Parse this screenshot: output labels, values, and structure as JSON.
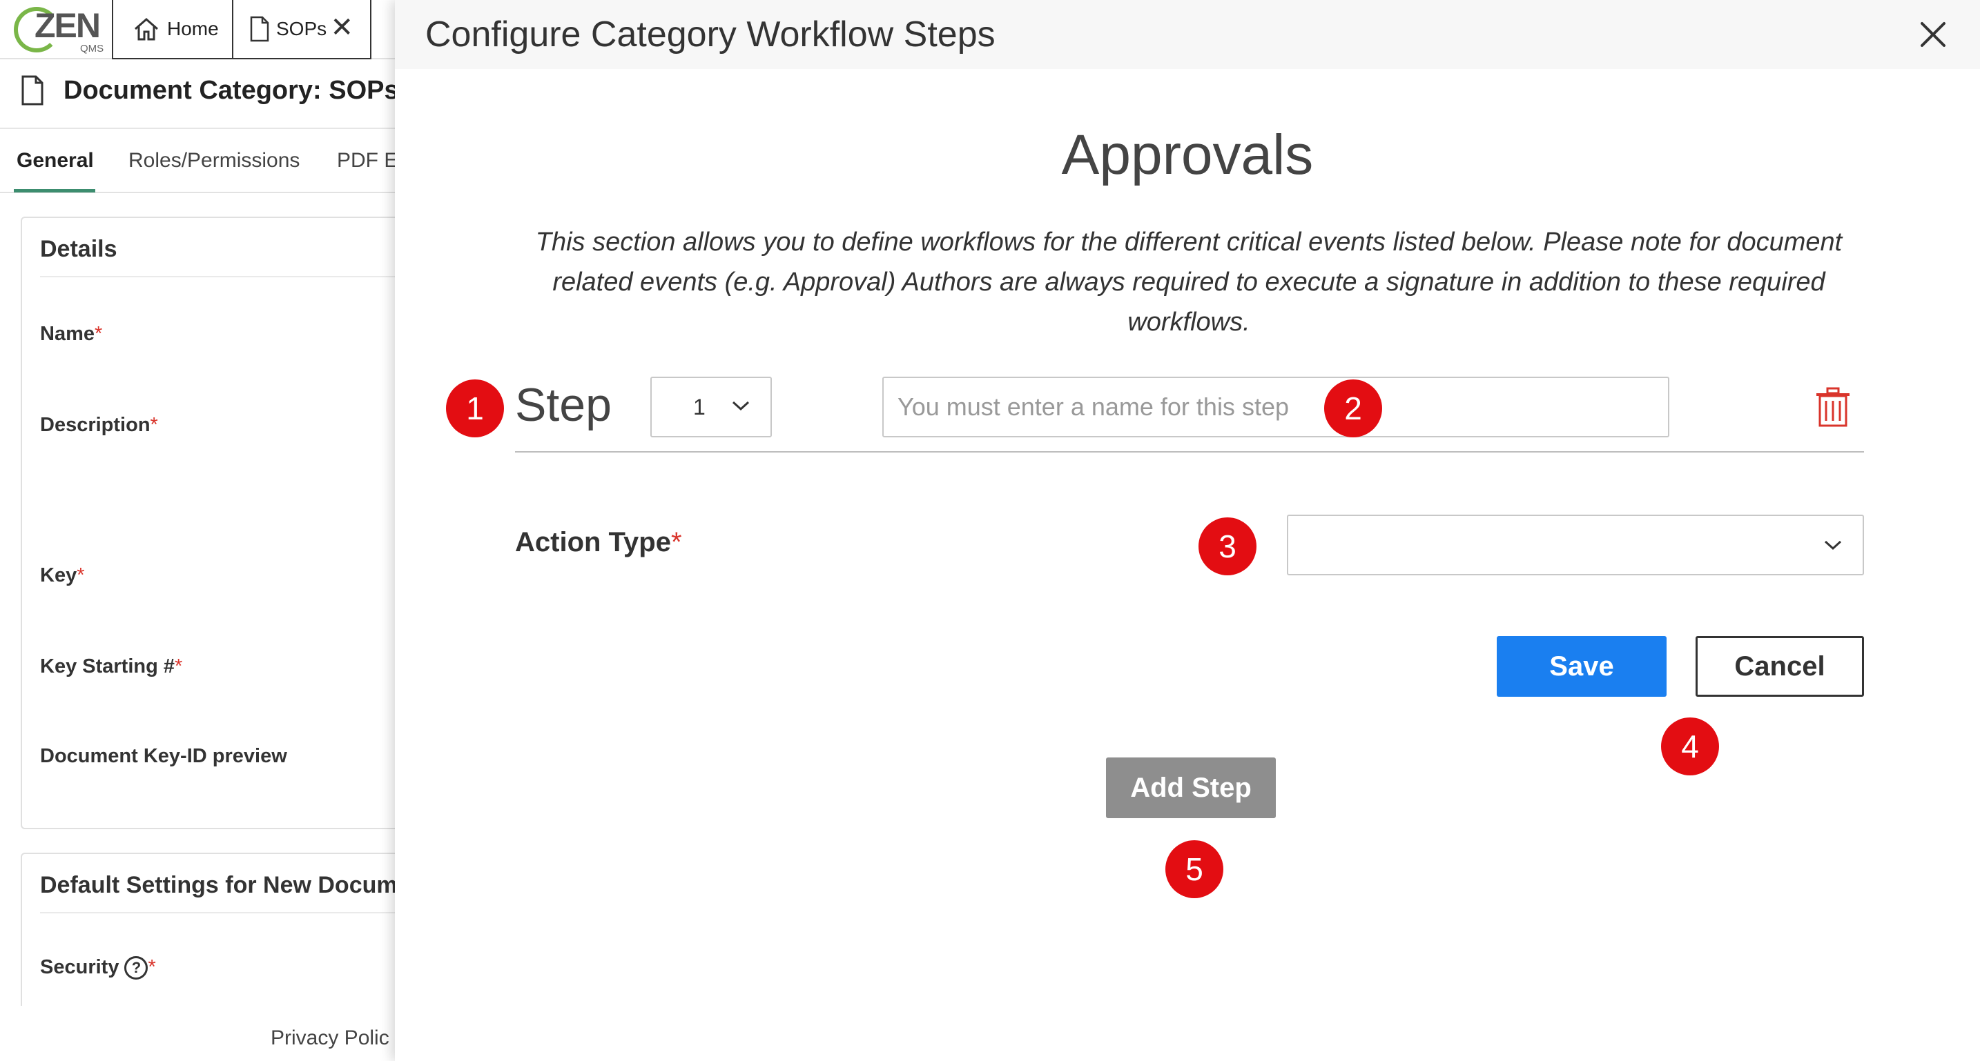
{
  "tabs": {
    "logo_text": "ZEN",
    "logo_sub": "QMS",
    "home_label": "Home",
    "sops_label": "SOPs"
  },
  "document": {
    "title": "Document Category: SOPs",
    "subtabs": [
      "General",
      "Roles/Permissions",
      "PDF E"
    ],
    "active_subtab": "General"
  },
  "details_panel": {
    "title": "Details",
    "fields": [
      {
        "label": "Name",
        "required": "*"
      },
      {
        "label": "Description",
        "required": "*"
      },
      {
        "label": "Key",
        "required": "*"
      },
      {
        "label": "Key Starting #",
        "required": "*"
      },
      {
        "label": "Document Key-ID preview",
        "required": ""
      }
    ]
  },
  "defaults_panel": {
    "title": "Default Settings for New Docume",
    "security_label": "Security",
    "security_help": "?",
    "required": "*"
  },
  "footer": {
    "privacy_link": "Privacy Polic"
  },
  "modal": {
    "title": "Configure Category Workflow Steps",
    "section_heading": "Approvals",
    "description": "This section allows you to define workflows for the different critical events listed below. Please note for document related events (e.g. Approval) Authors are always required to execute a signature in addition to these required workflows.",
    "step": {
      "label": "Step",
      "number": "1",
      "name_value": "",
      "name_placeholder": "You must enter a name for this step"
    },
    "action_type": {
      "label": "Action Type",
      "required": "*",
      "value": ""
    },
    "buttons": {
      "save": "Save",
      "cancel": "Cancel",
      "add_step": "Add Step"
    }
  },
  "markers": [
    "1",
    "2",
    "3",
    "4",
    "5"
  ],
  "colors": {
    "primary_button": "#1a7ff0",
    "add_step_button": "#8e8e8e",
    "marker": "#e30d12",
    "required_asterisk": "#d9342b",
    "trash_icon": "#d9342b",
    "active_tab_underline": "#3c8d6f"
  }
}
